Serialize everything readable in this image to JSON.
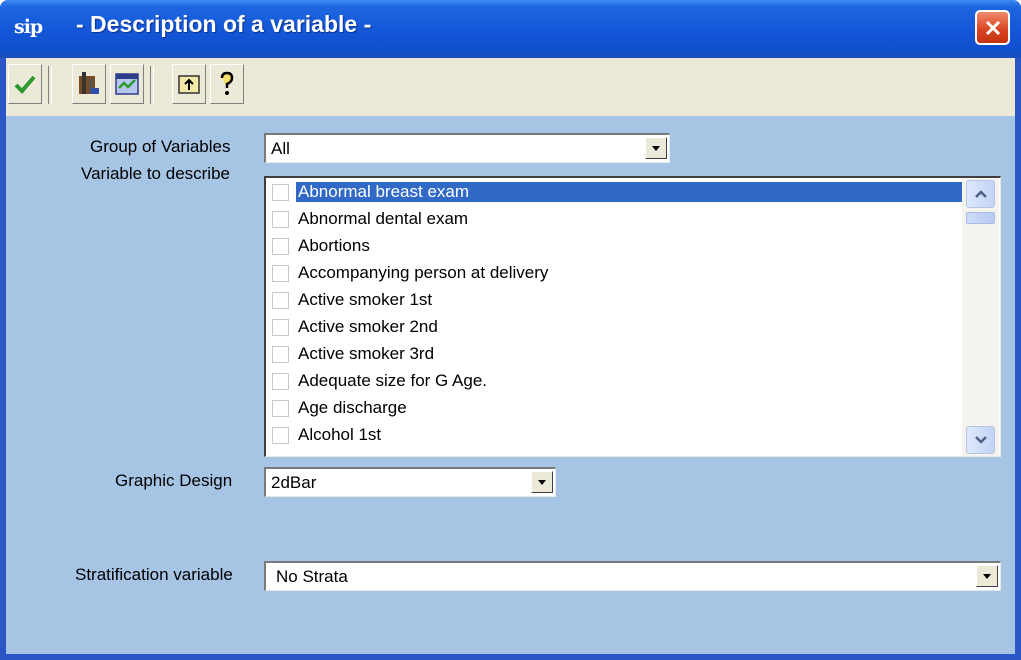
{
  "window": {
    "title": "- Description of a variable -",
    "app_icon_text": "sip"
  },
  "toolbar": {
    "buttons": [
      {
        "icon": "check-icon",
        "tooltip": ""
      },
      {
        "icon": "variable-tool-icon",
        "tooltip": ""
      },
      {
        "icon": "chart-window-icon",
        "tooltip": ""
      },
      {
        "icon": "exit-folder-icon",
        "tooltip": ""
      },
      {
        "icon": "help-icon",
        "tooltip": ""
      }
    ]
  },
  "form": {
    "group_label": "Group of Variables",
    "group_value": "All",
    "variable_label": "Variable to describe",
    "graphic_label": "Graphic Design",
    "graphic_value": "2dBar",
    "strat_label": "Stratification variable",
    "strat_value": "No Strata"
  },
  "variables": [
    {
      "label": "Abnormal breast exam",
      "selected": true,
      "checked": false
    },
    {
      "label": "Abnormal dental exam",
      "selected": false,
      "checked": false
    },
    {
      "label": "Abortions",
      "selected": false,
      "checked": false
    },
    {
      "label": "Accompanying person at delivery",
      "selected": false,
      "checked": false
    },
    {
      "label": "Active smoker 1st",
      "selected": false,
      "checked": false
    },
    {
      "label": "Active smoker 2nd",
      "selected": false,
      "checked": false
    },
    {
      "label": "Active smoker 3rd",
      "selected": false,
      "checked": false
    },
    {
      "label": "Adequate size for G Age.",
      "selected": false,
      "checked": false
    },
    {
      "label": "Age discharge",
      "selected": false,
      "checked": false
    },
    {
      "label": "Alcohol 1st",
      "selected": false,
      "checked": false
    }
  ],
  "colors": {
    "selection": "#3169c6",
    "content_bg": "#a6c4e4",
    "close_button": "#d8431f"
  }
}
